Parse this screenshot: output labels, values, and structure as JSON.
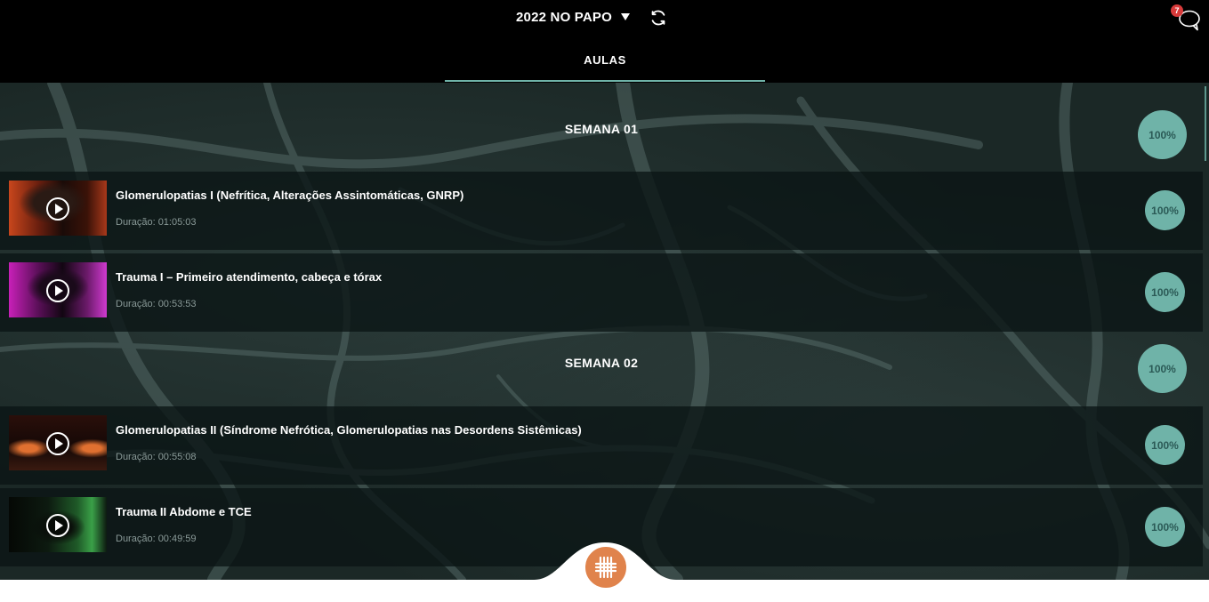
{
  "header": {
    "course_title": "2022 NO PAPO",
    "notification_count": "7",
    "tab_label": "AULAS"
  },
  "weeks": [
    {
      "title": "SEMANA 01",
      "progress": "100%",
      "lessons": [
        {
          "title": "Glomerulopatias I (Nefrítica, Alterações Assintomáticas, GNRP)",
          "duration": "Duração: 01:05:03",
          "progress": "100%"
        },
        {
          "title": "Trauma I – Primeiro atendimento, cabeça e tórax",
          "duration": "Duração: 00:53:53",
          "progress": "100%"
        }
      ]
    },
    {
      "title": "SEMANA 02",
      "progress": "100%",
      "lessons": [
        {
          "title": "Glomerulopatias II (Síndrome Nefrótica, Glomerulopatias nas Desordens Sistêmicas)",
          "duration": "Duração: 00:55:08",
          "progress": "100%"
        },
        {
          "title": "Trauma II Abdome e TCE",
          "duration": "Duração: 00:49:59",
          "progress": "100%"
        }
      ]
    }
  ],
  "colors": {
    "accent": "#6fb3a8",
    "badge": "#d83a3a",
    "fab": "#e0834c",
    "header_bg": "#000000"
  },
  "icons": [
    "chevron-down-icon",
    "refresh-icon",
    "chat-icon",
    "play-icon",
    "menu-logo-icon"
  ]
}
